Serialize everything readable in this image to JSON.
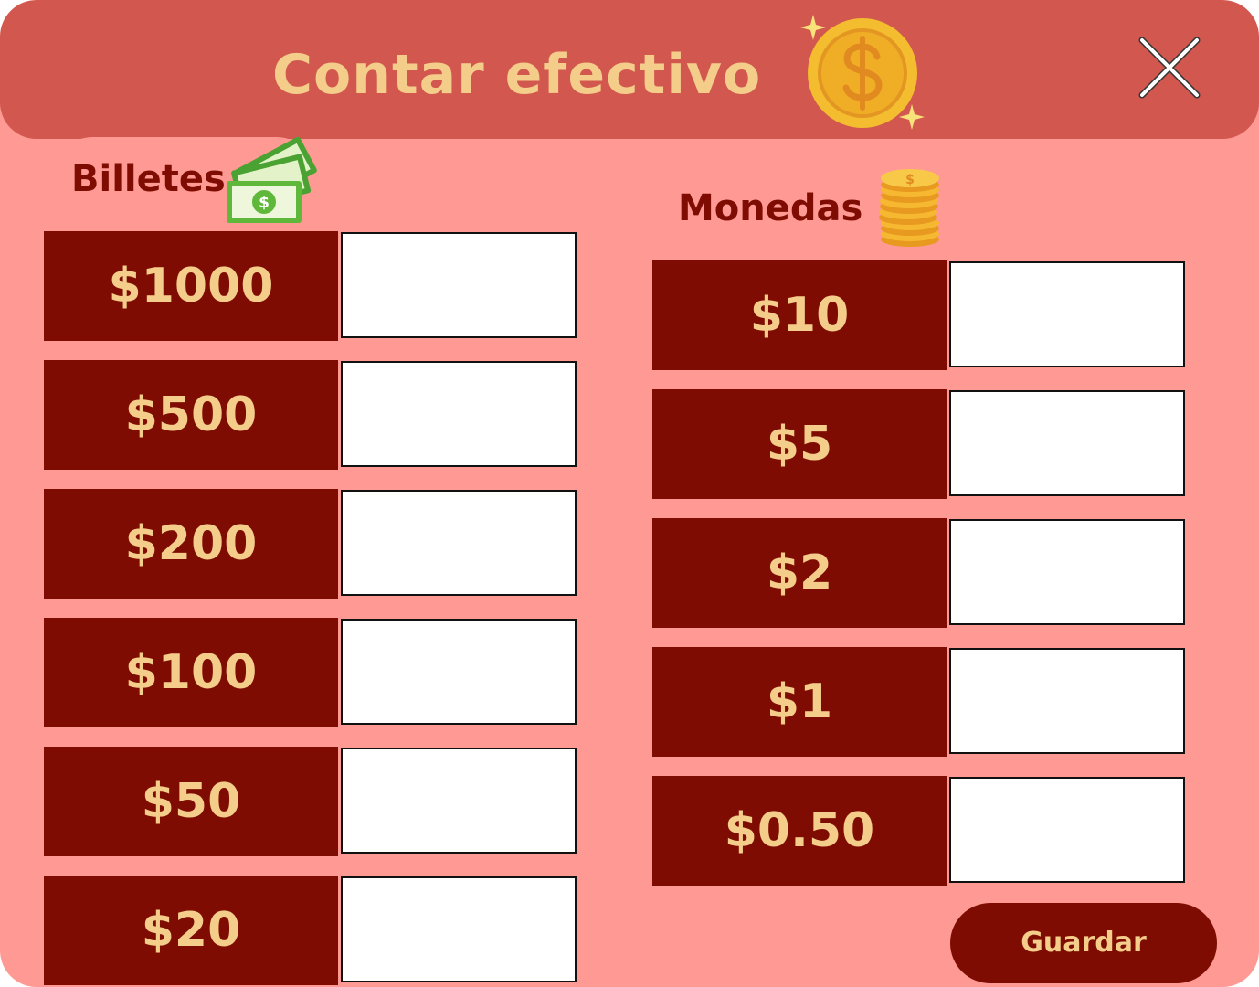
{
  "dialog": {
    "title": "Contar efectivo",
    "close_icon": "close-icon",
    "title_icon": "coin-icon"
  },
  "billetes": {
    "label": "Billetes",
    "icon": "banknotes-icon",
    "rows": [
      {
        "label": "$1000",
        "value": ""
      },
      {
        "label": "$500",
        "value": ""
      },
      {
        "label": "$200",
        "value": ""
      },
      {
        "label": "$100",
        "value": ""
      },
      {
        "label": "$50",
        "value": ""
      },
      {
        "label": "$20",
        "value": ""
      }
    ]
  },
  "monedas": {
    "label": "Monedas",
    "icon": "coin-stack-icon",
    "rows": [
      {
        "label": "$10",
        "value": ""
      },
      {
        "label": "$5",
        "value": ""
      },
      {
        "label": "$2",
        "value": ""
      },
      {
        "label": "$1",
        "value": ""
      },
      {
        "label": "$0.50",
        "value": ""
      }
    ]
  },
  "actions": {
    "save_label": "Guardar"
  },
  "colors": {
    "background": "#fe9a93",
    "header": "#d2574f",
    "dark_red": "#7e0c02",
    "gold_text": "#f4cd8a"
  }
}
